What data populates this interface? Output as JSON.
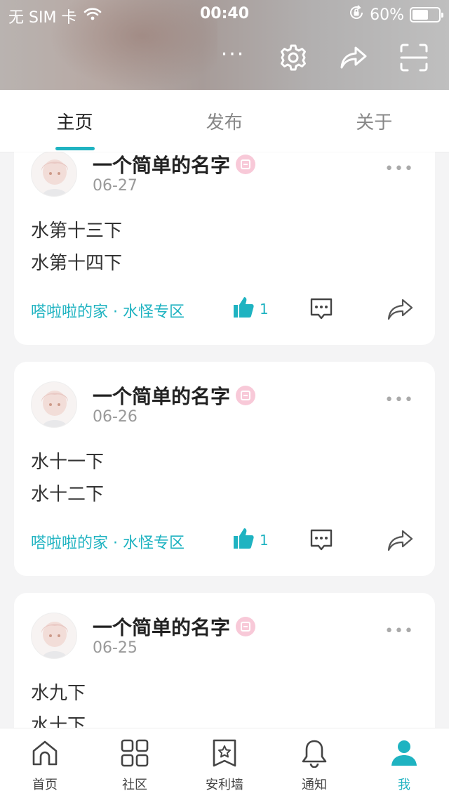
{
  "status_bar": {
    "carrier": "无 SIM 卡",
    "time": "00:40",
    "battery": "60%",
    "battery_level": 0.6
  },
  "header": {
    "more_label": "···"
  },
  "tabs": [
    {
      "label": "主页",
      "active": true
    },
    {
      "label": "发布",
      "active": false
    },
    {
      "label": "关于",
      "active": false
    }
  ],
  "posts": [
    {
      "author": "一个简单的名字",
      "date": "06-27",
      "lines": [
        "水第十三下",
        "水第十四下"
      ],
      "topic": "嗒啦啦的家 · 水怪专区",
      "likes": "1"
    },
    {
      "author": "一个简单的名字",
      "date": "06-26",
      "lines": [
        "水十一下",
        "水十二下"
      ],
      "topic": "嗒啦啦的家 · 水怪专区",
      "likes": "1"
    },
    {
      "author": "一个简单的名字",
      "date": "06-25",
      "lines": [
        "水九下",
        "水十下"
      ],
      "topic": "",
      "likes": ""
    }
  ],
  "bottom_nav": [
    {
      "label": "首页",
      "icon": "home-icon",
      "active": false
    },
    {
      "label": "社区",
      "icon": "grid-icon",
      "active": false
    },
    {
      "label": "安利墙",
      "icon": "bookmark-star-icon",
      "active": false
    },
    {
      "label": "通知",
      "icon": "bell-icon",
      "active": false
    },
    {
      "label": "我",
      "icon": "person-icon",
      "active": true
    }
  ],
  "colors": {
    "accent": "#1fb3c1",
    "badge": "#f8c9d8"
  }
}
